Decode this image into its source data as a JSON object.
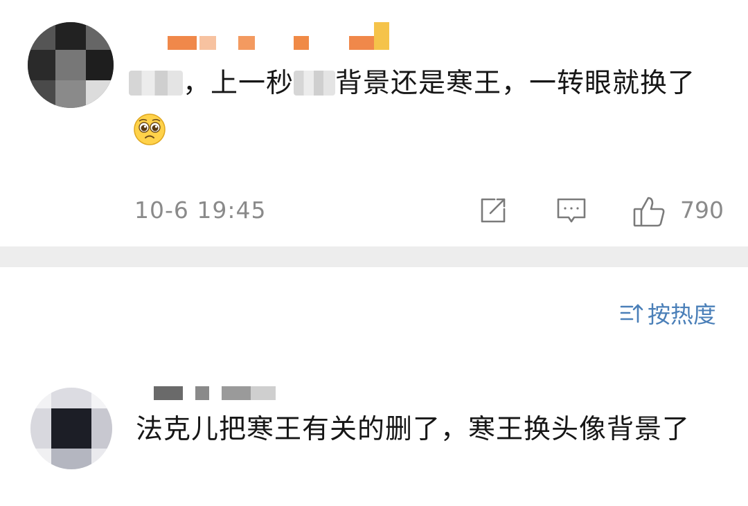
{
  "comments": [
    {
      "text_parts": [
        "，上一秒",
        "背景还是寒王，一转眼就换了"
      ],
      "time": "10-6 19:45",
      "likes": "790",
      "emoji_icon": "pleading-face-icon"
    },
    {
      "text": "法克儿把寒王有关的删了，寒王换头像背景了"
    }
  ],
  "sort": {
    "label": "按热度",
    "icon": "sort-icon"
  },
  "colors": {
    "accent": "#4a7fb8",
    "meta": "#8a8a8a",
    "divider": "#ededed"
  }
}
